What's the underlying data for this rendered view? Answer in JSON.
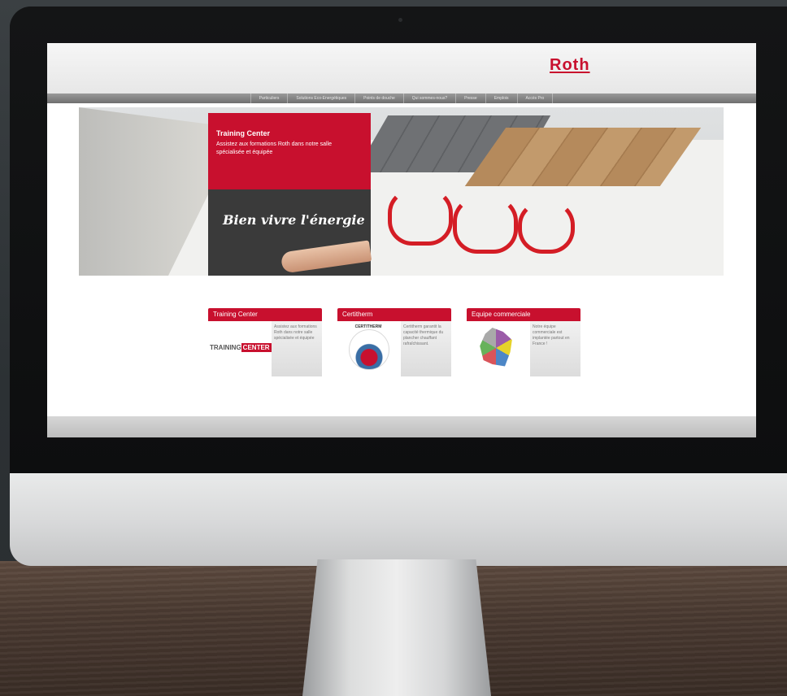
{
  "site": {
    "logo": "Roth",
    "brand_color": "#c8102e"
  },
  "nav": {
    "items": [
      "Particuliers",
      "Solutions Eco-Energétiques",
      "Points de douche",
      "Qui sommes-nous?",
      "Presse",
      "Emplois",
      "Accès Pro"
    ]
  },
  "hero": {
    "promo_title": "Training Center",
    "promo_text": "Assistez aux formations Roth dans notre salle spécialisée et équipée",
    "slogan": "Bien vivre l'énergie"
  },
  "cards": [
    {
      "title": "Training Center",
      "image_text_1": "TRAINING",
      "image_text_2": "CENTER",
      "text": "Assistez aux formations Roth dans notre salle spécialisée et équipée"
    },
    {
      "title": "Certitherm",
      "image_text": "CERTITHERM",
      "text": "Certitherm garantit la capacité thermique du plancher chauffant rafraîchissant."
    },
    {
      "title": "Equipe commerciale",
      "text": "Notre équipe commerciale est implantée partout en France !"
    }
  ],
  "footer": {
    "links": [
      "",
      "",
      "",
      "",
      ""
    ]
  }
}
